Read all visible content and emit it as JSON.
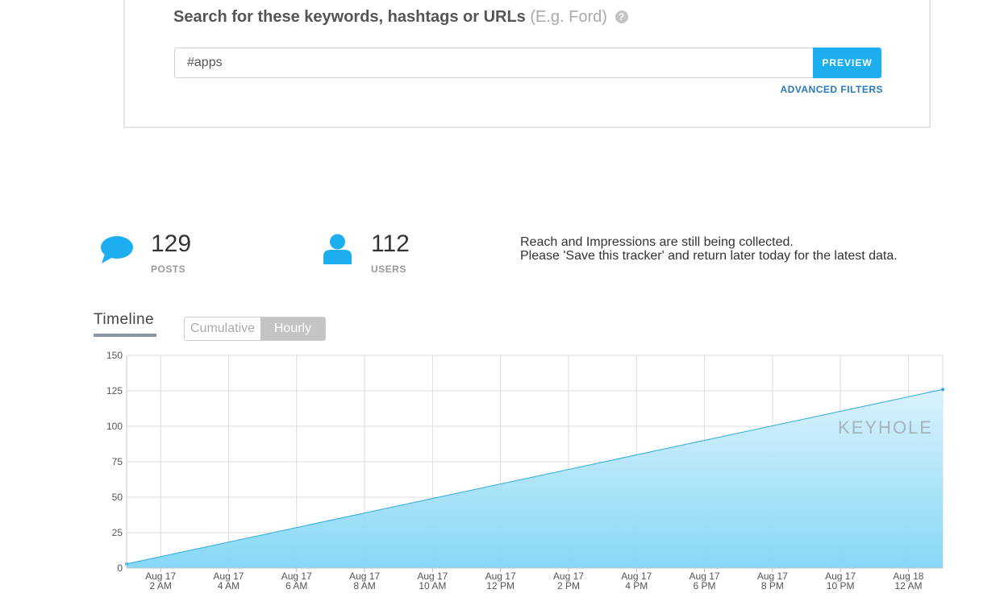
{
  "search": {
    "heading": "Search for these keywords, hashtags or URLs",
    "example": "(E.g. Ford)",
    "help_icon": "question-circle-icon",
    "input_value": "#apps",
    "preview_label": "PREVIEW",
    "advanced_filters_label": "ADVANCED FILTERS"
  },
  "stats": {
    "posts": {
      "value": "129",
      "label": "POSTS",
      "icon": "speech-bubble-icon"
    },
    "users": {
      "value": "112",
      "label": "USERS",
      "icon": "user-icon"
    },
    "note_line1": "Reach and Impressions are still being collected.",
    "note_line2": "Please 'Save this tracker' and return later today for the latest data."
  },
  "timeline": {
    "tab_label": "Timeline",
    "toggle_cumulative": "Cumulative",
    "toggle_hourly": "Hourly",
    "watermark": "KEYHOLE"
  },
  "colors": {
    "accent": "#1daef0",
    "area_top": "#c8ebfa",
    "area_bottom": "#7fd6f5",
    "line": "#2ba9de"
  },
  "chart_data": {
    "type": "area",
    "x_tick_labels": [
      [
        "Aug 17",
        "2 AM"
      ],
      [
        "Aug 17",
        "4 AM"
      ],
      [
        "Aug 17",
        "6 AM"
      ],
      [
        "Aug 17",
        "8 AM"
      ],
      [
        "Aug 17",
        "10 AM"
      ],
      [
        "Aug 17",
        "12 PM"
      ],
      [
        "Aug 17",
        "2 PM"
      ],
      [
        "Aug 17",
        "4 PM"
      ],
      [
        "Aug 17",
        "6 PM"
      ],
      [
        "Aug 17",
        "8 PM"
      ],
      [
        "Aug 17",
        "10 PM"
      ],
      [
        "Aug 18",
        "12 AM"
      ]
    ],
    "x": [
      "Aug 17 1 AM",
      "Aug 18 1 AM"
    ],
    "series": [
      {
        "values": [
          3,
          126
        ]
      }
    ],
    "ylim": [
      0,
      150
    ],
    "y_ticks": [
      0,
      25,
      50,
      75,
      100,
      125,
      150
    ],
    "grid": true,
    "legend": "none"
  }
}
